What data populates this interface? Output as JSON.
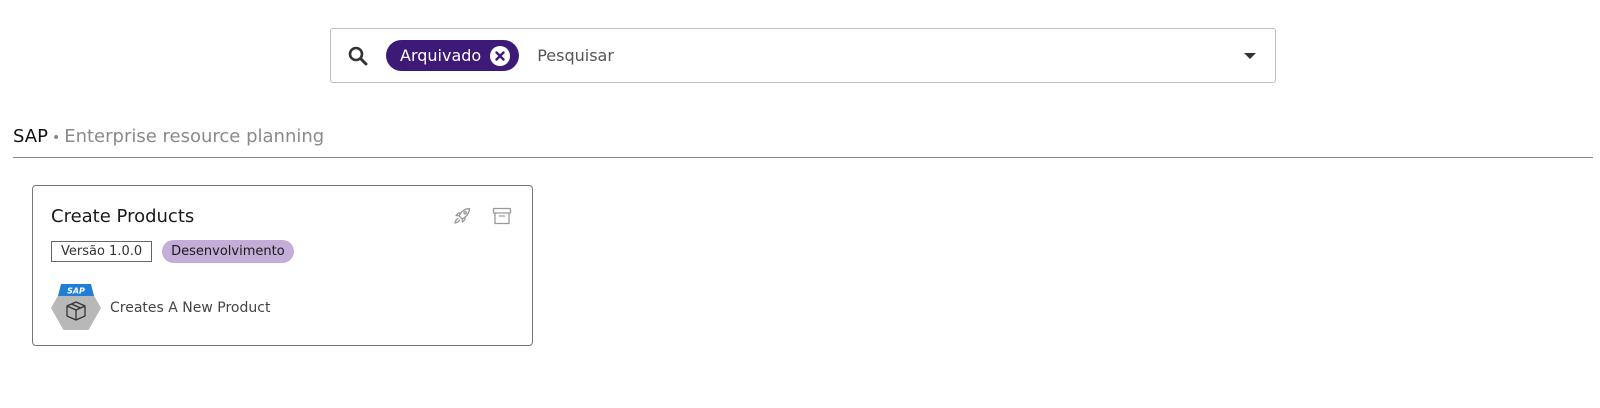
{
  "search": {
    "chip_label": "Arquivado",
    "placeholder": "Pesquisar",
    "value": ""
  },
  "section": {
    "title": "SAP",
    "separator": "•",
    "subtitle": "Enterprise resource planning"
  },
  "cards": [
    {
      "title": "Create Products",
      "version": "Versão 1.0.0",
      "status": "Desenvolvimento",
      "app_badge": "SAP",
      "description": "Creates A New Product",
      "actions": [
        "rocket-icon",
        "archive-icon"
      ]
    }
  ],
  "colors": {
    "chip_bg": "#3d1a78",
    "status_bg": "#c4add8",
    "sap_blue": "#1f7fd6",
    "hexagon_gray": "#b8b8b8"
  }
}
